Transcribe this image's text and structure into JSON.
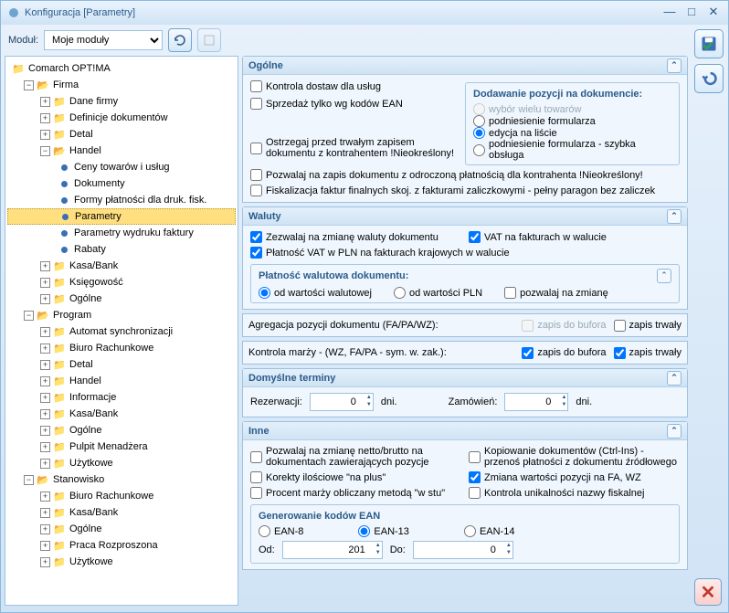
{
  "window": {
    "title": "Konfiguracja [Parametry]"
  },
  "topbar": {
    "module_label": "Moduł:",
    "module_value": "Moje moduły"
  },
  "tree": {
    "root": "Comarch OPT!MA",
    "firma": "Firma",
    "firma_items": [
      "Dane firmy",
      "Definicje dokumentów",
      "Detal",
      "Handel"
    ],
    "handel_items": [
      "Ceny towarów i usług",
      "Dokumenty",
      "Formy płatności dla druk. fisk.",
      "Parametry",
      "Parametry wydruku faktury",
      "Rabaty"
    ],
    "firma_rest": [
      "Kasa/Bank",
      "Księgowość",
      "Ogólne"
    ],
    "program": "Program",
    "program_items": [
      "Automat synchronizacji",
      "Biuro Rachunkowe",
      "Detal",
      "Handel",
      "Informacje",
      "Kasa/Bank",
      "Ogólne",
      "Pulpit Menadżera",
      "Użytkowe"
    ],
    "stan": "Stanowisko",
    "stan_items": [
      "Biuro Rachunkowe",
      "Kasa/Bank",
      "Ogólne",
      "Praca Rozproszona",
      "Użytkowe"
    ]
  },
  "ogolne": {
    "title": "Ogólne",
    "c1": "Kontrola dostaw dla usług",
    "c2": "Sprzedaż tylko wg kodów EAN",
    "c3": "Ostrzegaj przed trwałym zapisem dokumentu z kontrahentem !Nieokreślony!",
    "c4": "Pozwalaj na zapis dokumentu z odroczoną płatnością dla kontrahenta !Nieokreślony!",
    "c5": "Fiskalizacja faktur finalnych skoj. z fakturami zaliczkowymi - pełny paragon bez zaliczek",
    "dod_hd": "Dodawanie pozycji na dokumencie:",
    "r1": "wybór wielu towarów",
    "r2": "podniesienie formularza",
    "r3": "edycja na liście",
    "r4": "podniesienie formularza - szybka obsługa"
  },
  "waluty": {
    "title": "Waluty",
    "c1": "Zezwalaj na zmianę waluty dokumentu",
    "c2": "VAT na fakturach w walucie",
    "c3": "Płatność VAT w PLN na fakturach krajowych w walucie",
    "sub_hd": "Płatność walutowa dokumentu:",
    "r1": "od wartości walutowej",
    "r2": "od wartości PLN",
    "cz": "pozwalaj na zmianę"
  },
  "agreg": {
    "l1": "Agregacja pozycji dokumentu (FA/PA/WZ):",
    "l2": "Kontrola marży - (WZ, FA/PA - sym. w. zak.):",
    "b": "zapis do bufora",
    "t": "zapis trwały"
  },
  "terminy": {
    "title": "Domyślne terminy",
    "rez": "Rezerwacji:",
    "rezv": "0",
    "zam": "Zamówień:",
    "zamv": "0",
    "dni": "dni."
  },
  "inne": {
    "title": "Inne",
    "c1": "Pozwalaj na zmianę netto/brutto na dokumentach zawierających pozycje",
    "c2": "Korekty ilościowe \"na plus\"",
    "c3": "Procent marży obliczany metodą \"w stu\"",
    "c4": "Kopiowanie dokumentów (Ctrl-Ins) - przenoś płatności z dokumentu źródłowego",
    "c5": "Zmiana wartości pozycji na FA, WZ",
    "c6": "Kontrola unikalności nazwy fiskalnej",
    "ean_hd": "Generowanie kodów EAN",
    "e8": "EAN-8",
    "e13": "EAN-13",
    "e14": "EAN-14",
    "od": "Od:",
    "odv": "201",
    "do": "Do:",
    "dov": "0"
  }
}
